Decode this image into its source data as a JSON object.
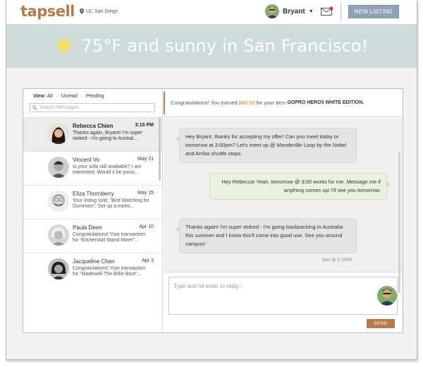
{
  "header": {
    "logo": "tapsell",
    "location": "UC San Diego",
    "user_name": "Bryant",
    "new_listing_label": "NEW LISTING"
  },
  "banner": {
    "weather_text": "75°F and sunny in San Francisco!"
  },
  "filters": {
    "view_label": "View:",
    "all": "All",
    "unread": "Unread",
    "pending": "Pending",
    "separator": "·"
  },
  "search": {
    "placeholder": "Search Messages"
  },
  "threads": [
    {
      "name": "Rebecca Chien",
      "date": "3:15 PM",
      "preview": "Thanks again, Bryant! I'm super stoked - I'm going to Austral...",
      "active": true
    },
    {
      "name": "Vincent Vo",
      "date": "May 21",
      "preview": "Is your sofa still available? I am interested. Would it be possi..."
    },
    {
      "name": "Eliza Thornberry",
      "date": "May 15",
      "preview": "Your listing sold: \"Bird Watching for Dummies\". Set up a meeti..."
    },
    {
      "name": "Paula Deen",
      "date": "Apr 10",
      "preview": "Congratulations! Your transaction for \"KitchenAid Stand Mixer\"..."
    },
    {
      "name": "Jacqueline Chen",
      "date": "Apr 3",
      "preview": "Congratulations! Your transaction for \"Madewell The Billie Boot\"..."
    }
  ],
  "notice": {
    "prefix": "Congratulations! You earned",
    "amount": "$80.00",
    "middle": "for your item",
    "item": "GOPRO HERO3 WHITE EDITION."
  },
  "messages": [
    {
      "direction": "in",
      "text": "Hey Bryant, thanks for accepting my offer! Can you meet today or tomorrow at 3:00pm? Let's meet up @ Mandeville Loop by the Nobel and Arriba shuttle stops."
    },
    {
      "direction": "out",
      "text": "Hey Rebecca! Yeah, tomorrow @ 3:00 works for me. Message me if anything comes up! I'll see you tomorrow."
    },
    {
      "direction": "in",
      "text": "Thanks again! I'm super stoked - I'm going backpacking in Australia this summer and I know this'll come into good use. See you around campus!"
    }
  ],
  "sent_label": "Sent @ 3:15PM",
  "reply": {
    "placeholder": "Type and hit enter to reply...",
    "send_label": "SEND"
  },
  "colors": {
    "brand": "#b87a4b",
    "banner": "#cfdadb",
    "button": "#8ea3b7",
    "outgoing_bubble": "#e9f1e1"
  }
}
